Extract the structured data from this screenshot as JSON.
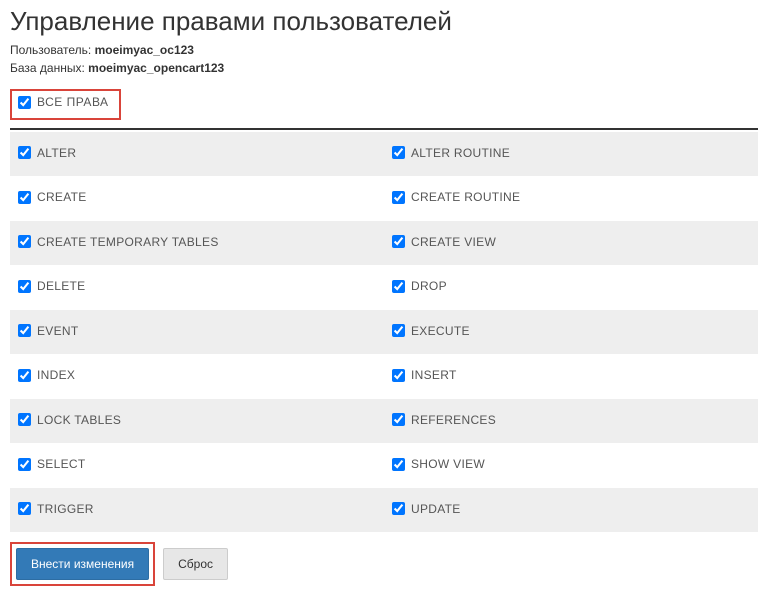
{
  "header": {
    "title": "Управление правами пользователей",
    "user_label": "Пользователь:",
    "user_value": "moeimyac_oc123",
    "db_label": "База данных:",
    "db_value": "moeimyac_opencart123"
  },
  "all_rights_label": "ВСЕ ПРАВА",
  "privileges": [
    {
      "left": "ALTER",
      "right": "ALTER ROUTINE"
    },
    {
      "left": "CREATE",
      "right": "CREATE ROUTINE"
    },
    {
      "left": "CREATE TEMPORARY TABLES",
      "right": "CREATE VIEW"
    },
    {
      "left": "DELETE",
      "right": "DROP"
    },
    {
      "left": "EVENT",
      "right": "EXECUTE"
    },
    {
      "left": "INDEX",
      "right": "INSERT"
    },
    {
      "left": "LOCK TABLES",
      "right": "REFERENCES"
    },
    {
      "left": "SELECT",
      "right": "SHOW VIEW"
    },
    {
      "left": "TRIGGER",
      "right": "UPDATE"
    }
  ],
  "actions": {
    "submit": "Внести изменения",
    "reset": "Сброс"
  }
}
